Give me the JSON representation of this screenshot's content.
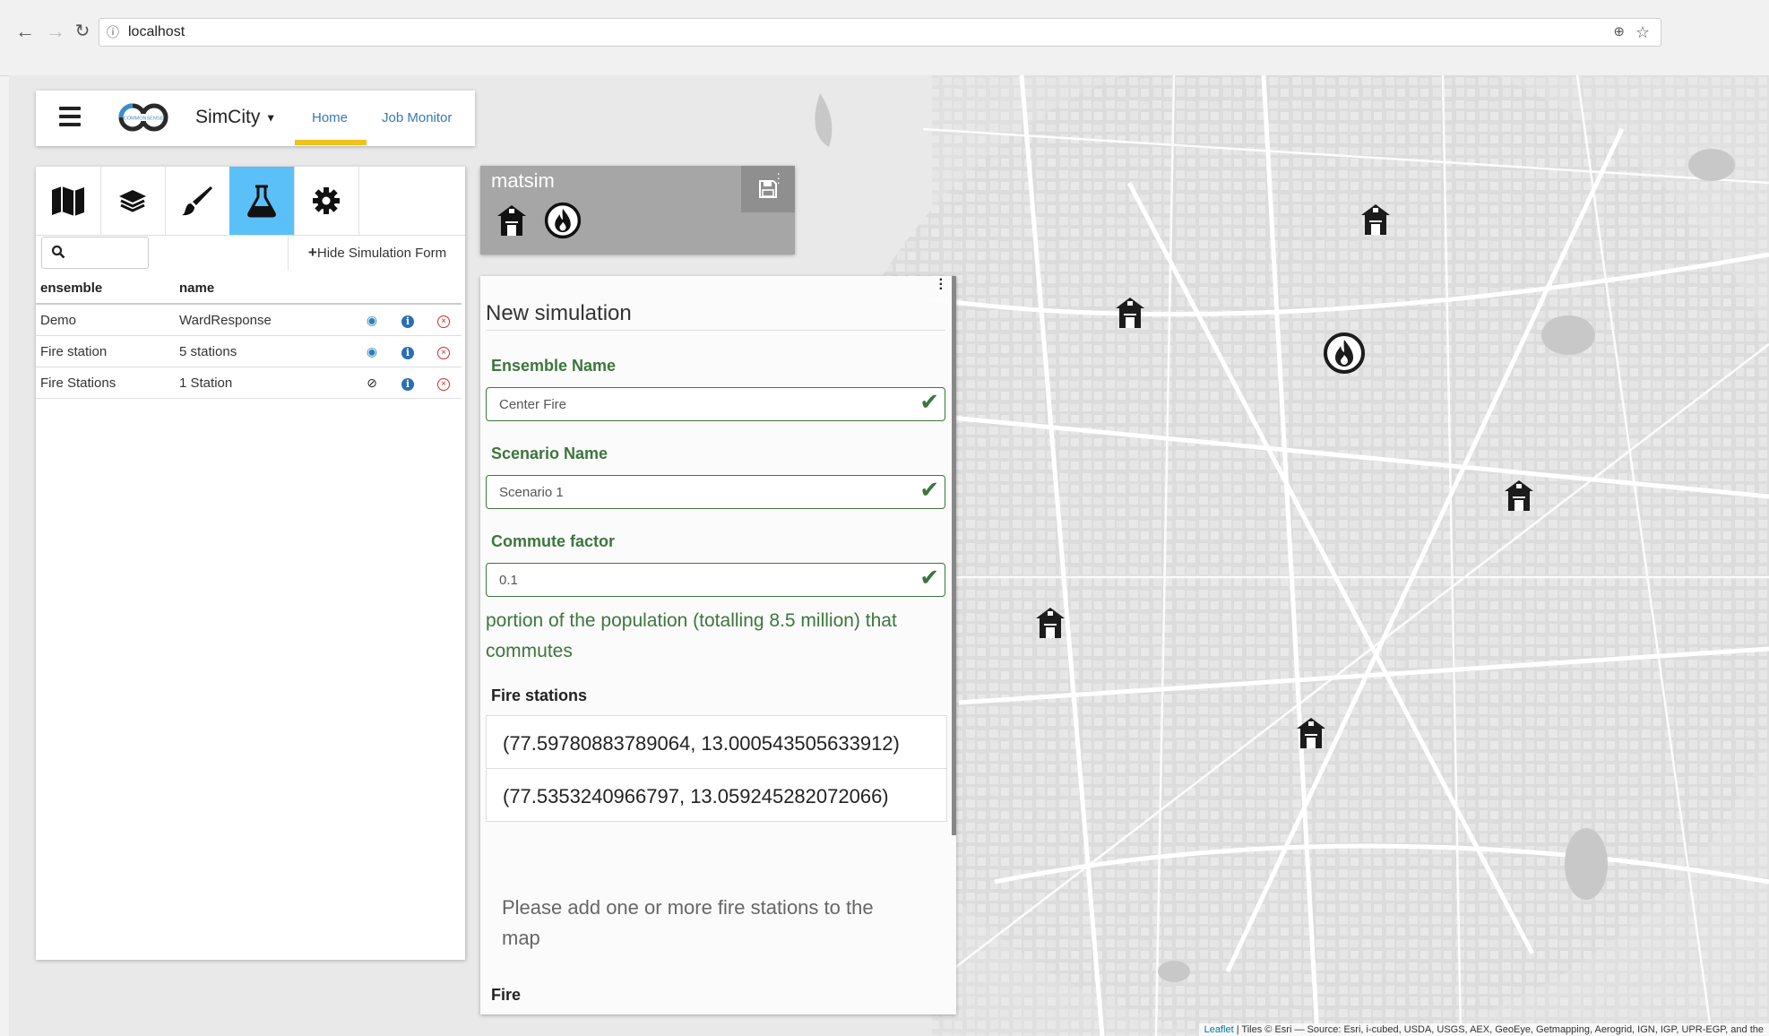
{
  "browser": {
    "url": "localhost"
  },
  "navbar": {
    "brand": "SimCity",
    "tabs": [
      {
        "label": "Home",
        "active": true
      },
      {
        "label": "Job Monitor",
        "active": false
      }
    ],
    "accent_color": "#f2c21a",
    "logo_text": "COMMONSENSE"
  },
  "left_panel": {
    "tools": [
      {
        "icon": "map-icon"
      },
      {
        "icon": "layers-icon"
      },
      {
        "icon": "brush-icon"
      },
      {
        "icon": "flask-icon",
        "active": true
      },
      {
        "icon": "gear-icon"
      }
    ],
    "active_color": "#5bc0f8",
    "hide_form_label": "Hide Simulation Form",
    "table": {
      "columns": [
        "ensemble",
        "name"
      ],
      "rows": [
        {
          "ensemble": "Demo",
          "name": "WardResponse",
          "visibility": "visible"
        },
        {
          "ensemble": "Fire station",
          "name": "5 stations",
          "visibility": "visible"
        },
        {
          "ensemble": "Fire Stations",
          "name": "1 Station",
          "visibility": "hidden"
        }
      ]
    }
  },
  "model_card": {
    "title": "matsim",
    "icons": [
      "fire-station-icon",
      "fire-icon"
    ]
  },
  "form": {
    "title": "New simulation",
    "fields": [
      {
        "label": "Ensemble Name",
        "value": "Center Fire"
      },
      {
        "label": "Scenario Name",
        "value": "Scenario 1"
      },
      {
        "label": "Commute factor",
        "value": "0.1"
      }
    ],
    "commute_help": "portion of the population (totalling 8.5 million) that commutes",
    "fire_stations_label": "Fire stations",
    "fire_stations": [
      "(77.59780883789064, 13.000543505633912)",
      "(77.5353240966797, 13.059245282072066)"
    ],
    "empty_message": "Please add one or more fire stations to the map",
    "fire_label": "Fire",
    "valid_color": "#3c763d"
  },
  "map": {
    "markers": [
      {
        "type": "fire-station-icon"
      },
      {
        "type": "fire-station-icon"
      },
      {
        "type": "fire-icon"
      },
      {
        "type": "fire-station-icon"
      },
      {
        "type": "fire-station-icon"
      },
      {
        "type": "fire-station-icon"
      }
    ],
    "attribution_link": "Leaflet",
    "attribution_text": " | Tiles © Esri — Source: Esri, i-cubed, USDA, USGS, AEX, GeoEye, Getmapping, Aerogrid, IGN, IGP, UPR-EGP, and the"
  }
}
